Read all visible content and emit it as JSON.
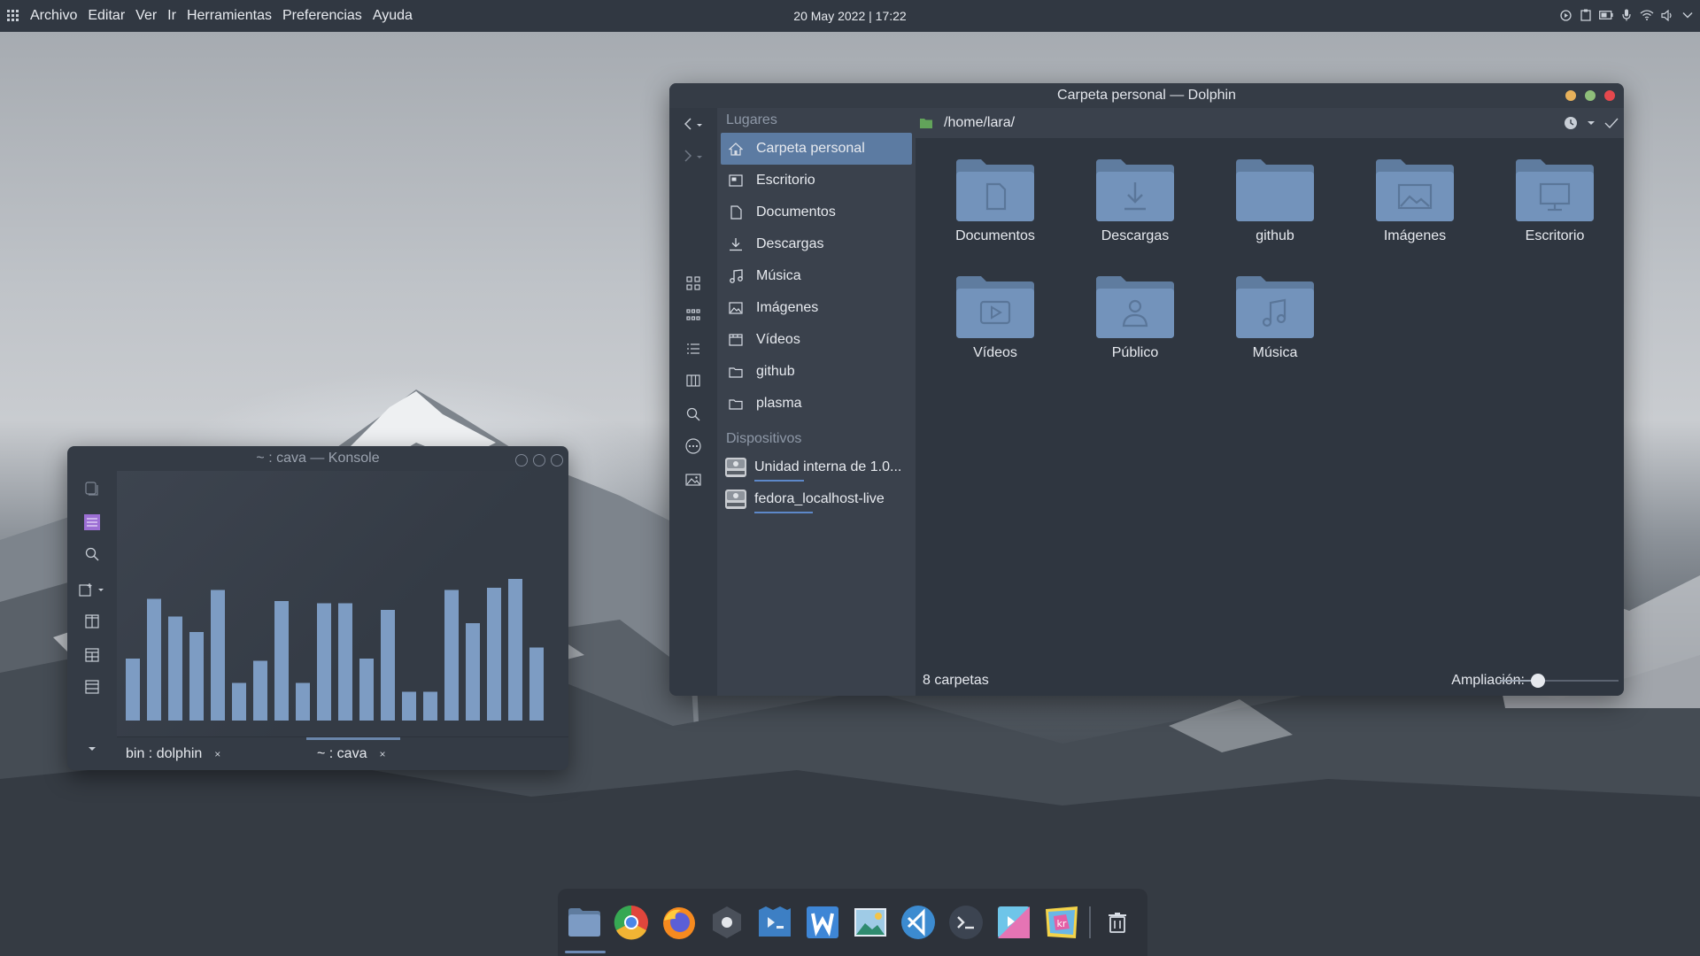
{
  "topbar": {
    "menu": [
      "Archivo",
      "Editar",
      "Ver",
      "Ir",
      "Herramientas",
      "Preferencias",
      "Ayuda"
    ],
    "datetime": "20 May 2022 | 17:22",
    "tray_icons": [
      "media-icon",
      "clipboard-icon",
      "battery-icon",
      "microphone-icon",
      "wifi-icon",
      "volume-icon",
      "chevron-down-icon"
    ]
  },
  "dolphin": {
    "title": "Carpeta personal — Dolphin",
    "places_header": "Lugares",
    "places": [
      {
        "label": "Carpeta personal",
        "icon": "home-icon",
        "active": true
      },
      {
        "label": "Escritorio",
        "icon": "desktop-icon"
      },
      {
        "label": "Documentos",
        "icon": "document-icon"
      },
      {
        "label": "Descargas",
        "icon": "download-icon"
      },
      {
        "label": "Música",
        "icon": "music-icon"
      },
      {
        "label": "Imágenes",
        "icon": "image-icon"
      },
      {
        "label": "Vídeos",
        "icon": "video-icon"
      },
      {
        "label": "github",
        "icon": "folder-icon"
      },
      {
        "label": "plasma",
        "icon": "folder-icon"
      }
    ],
    "devices_header": "Dispositivos",
    "devices": [
      {
        "label": "Unidad interna de 1.0...",
        "usage": 0.33
      },
      {
        "label": "fedora_localhost-live",
        "usage": 0.39
      }
    ],
    "path": "/home/lara/",
    "folders": [
      {
        "label": "Documentos",
        "icon": "document-folder-icon"
      },
      {
        "label": "Descargas",
        "icon": "download-folder-icon"
      },
      {
        "label": "github",
        "icon": "folder-icon"
      },
      {
        "label": "Imágenes",
        "icon": "image-folder-icon"
      },
      {
        "label": "Escritorio",
        "icon": "desktop-folder-icon"
      },
      {
        "label": "Vídeos",
        "icon": "video-folder-icon"
      },
      {
        "label": "Público",
        "icon": "public-folder-icon"
      },
      {
        "label": "Música",
        "icon": "music-folder-icon"
      }
    ],
    "status_count": "8 carpetas",
    "zoom_label": "Ampliación:",
    "zoom_level": 0.3,
    "colors": {
      "close": "#e5484d",
      "maximize": "#8fbf7a",
      "minimize": "#e7b15b",
      "accent": "#5c7ba2"
    }
  },
  "konsole": {
    "title": "~ : cava — Konsole",
    "bar_levels": [
      0.28,
      0.55,
      0.47,
      0.4,
      0.59,
      0.17,
      0.27,
      0.54,
      0.17,
      0.53,
      0.53,
      0.28,
      0.5,
      0.13,
      0.13,
      0.59,
      0.44,
      0.6,
      0.64,
      0.33
    ],
    "tabs": [
      {
        "label": "bin : dolphin",
        "close": "×",
        "active": false
      },
      {
        "label": "~ : cava",
        "close": "×",
        "active": true
      }
    ]
  },
  "dock": {
    "apps": [
      "files-icon",
      "chrome-icon",
      "firefox-icon",
      "settings-icon",
      "kate-icon",
      "writer-icon",
      "image-viewer-icon",
      "vscode-icon",
      "terminal-icon",
      "kdevelop-icon",
      "krita-icon",
      "trash-icon"
    ]
  }
}
